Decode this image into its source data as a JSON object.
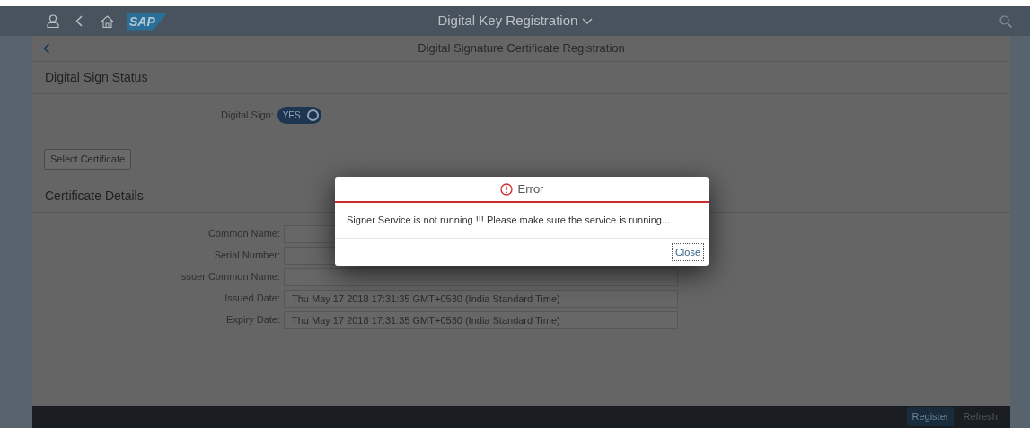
{
  "shell": {
    "logo": "SAP",
    "title": "Digital Key Registration"
  },
  "page": {
    "title": "Digital Signature Certificate Registration"
  },
  "status_section": {
    "heading": "Digital Sign Status",
    "toggle": {
      "label": "Digital Sign:",
      "on": true,
      "on_text": "YES"
    },
    "select_button": "Select Certificate"
  },
  "details_section": {
    "heading": "Certificate Details",
    "fields": [
      {
        "label": "Common Name:"
      },
      {
        "label": "Serial Number:"
      },
      {
        "label": "Issuer Common Name:"
      },
      {
        "label": "Issued Date:",
        "value": "Thu May 17 2018 17:31:35 GMT+0530 (India Standard Time)"
      },
      {
        "label": "Expiry Date:",
        "value": "Thu May 17 2018 17:31:35 GMT+0530 (India Standard Time)"
      }
    ]
  },
  "footer": {
    "buttons": [
      {
        "label": "Register",
        "kind": "emphasized"
      },
      {
        "label": "Refresh",
        "kind": "transparent"
      }
    ]
  },
  "dialog": {
    "title": "Error",
    "message": "Signer Service is not running !!! Please make sure the service is running...",
    "button": "Close"
  }
}
